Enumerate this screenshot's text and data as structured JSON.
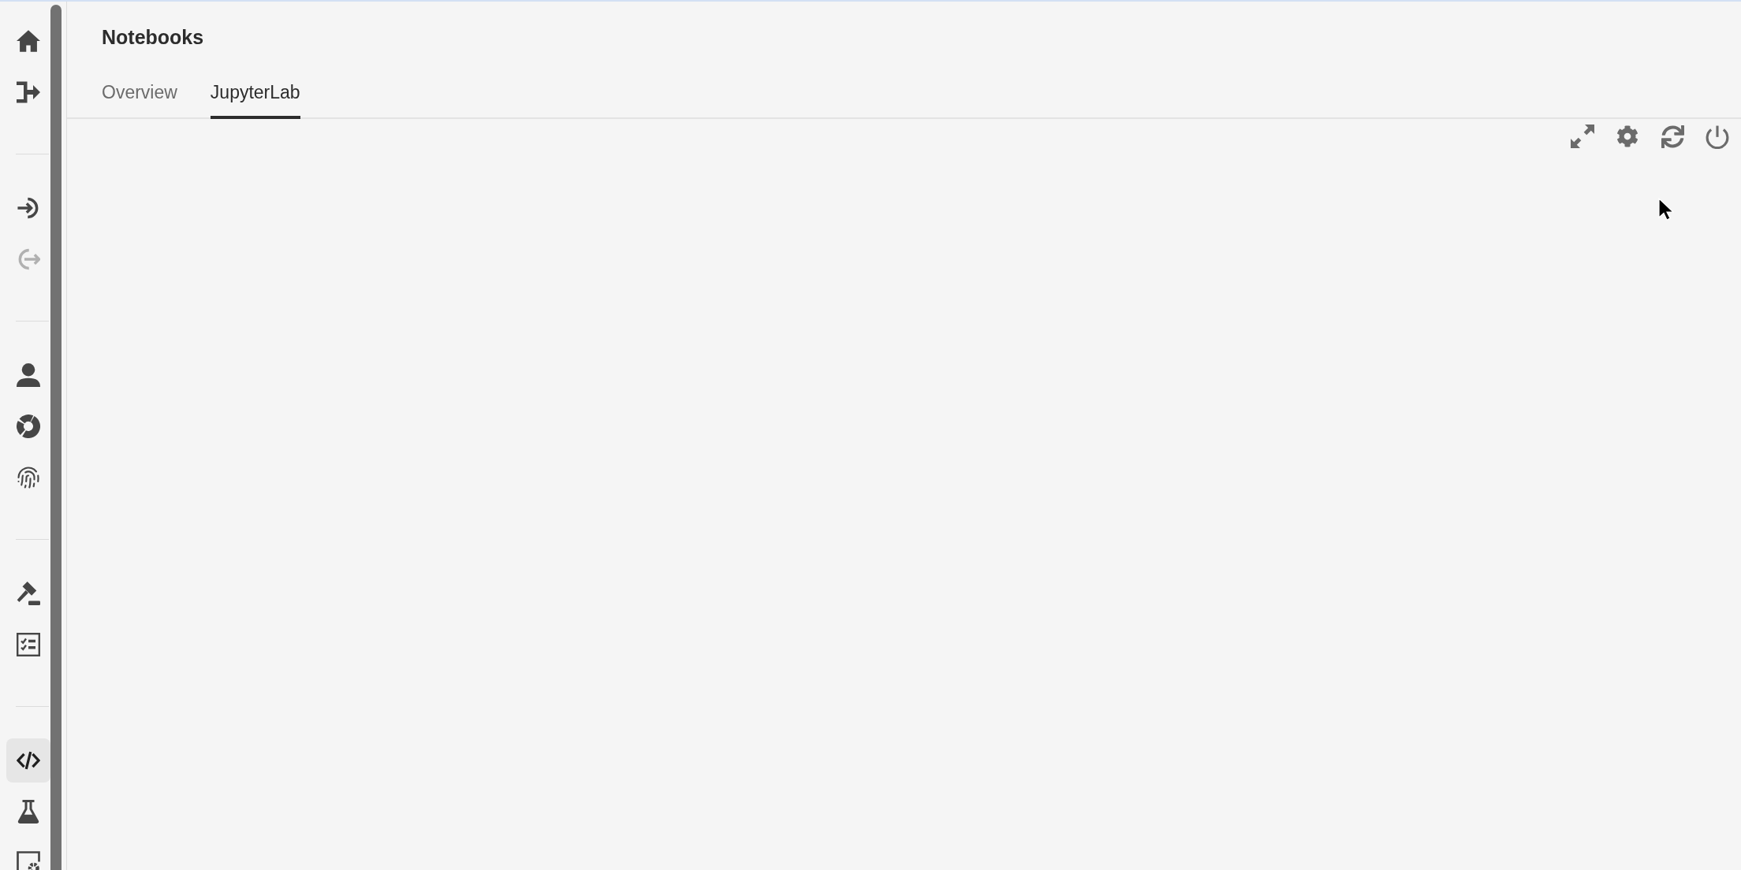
{
  "sidebar": {
    "groups": [
      {
        "items": [
          {
            "selected": false,
            "disabled": false
          },
          {
            "selected": false,
            "disabled": false
          }
        ]
      },
      {
        "items": [
          {
            "selected": false,
            "disabled": false
          },
          {
            "selected": false,
            "disabled": true
          }
        ]
      },
      {
        "items": [
          {
            "selected": false,
            "disabled": false
          },
          {
            "selected": false,
            "disabled": false
          },
          {
            "selected": false,
            "disabled": false
          }
        ]
      },
      {
        "items": [
          {
            "selected": false,
            "disabled": false
          },
          {
            "selected": false,
            "disabled": false
          }
        ]
      },
      {
        "items": [
          {
            "selected": true,
            "disabled": false
          },
          {
            "selected": false,
            "disabled": false
          },
          {
            "selected": false,
            "disabled": false
          }
        ]
      }
    ]
  },
  "page": {
    "title": "Notebooks",
    "tabs": [
      {
        "label": "Overview",
        "selected": false
      },
      {
        "label": "JupyterLab",
        "selected": true
      }
    ]
  }
}
